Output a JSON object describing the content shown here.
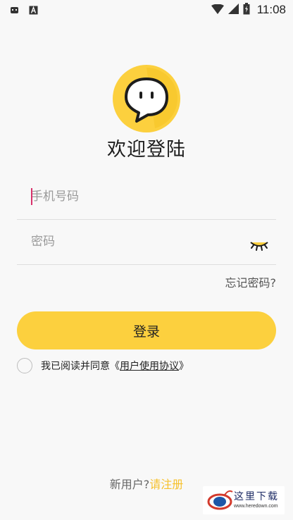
{
  "status_bar": {
    "time": "11:08",
    "left_icons": [
      "notification-icon",
      "text-a-icon"
    ],
    "right_icons": [
      "wifi-icon",
      "signal-icon",
      "battery-icon"
    ]
  },
  "login": {
    "title": "欢迎登陆",
    "phone_placeholder": "手机号码",
    "password_placeholder": "密码",
    "forgot_password": "忘记密码?",
    "login_button": "登录",
    "agree_prefix": "我已阅读并同意",
    "agreement_open": "《",
    "agreement_link": "用户使用协议",
    "agreement_close": "》",
    "new_user_prefix": "新用户?",
    "register_link": "请注册"
  },
  "watermark": {
    "site_name": "这里下载",
    "url": "www.heredown.com"
  },
  "colors": {
    "accent": "#fcd03e",
    "register_link": "#f6c12c",
    "cursor": "#d8316b",
    "background": "#f8f8f8"
  }
}
